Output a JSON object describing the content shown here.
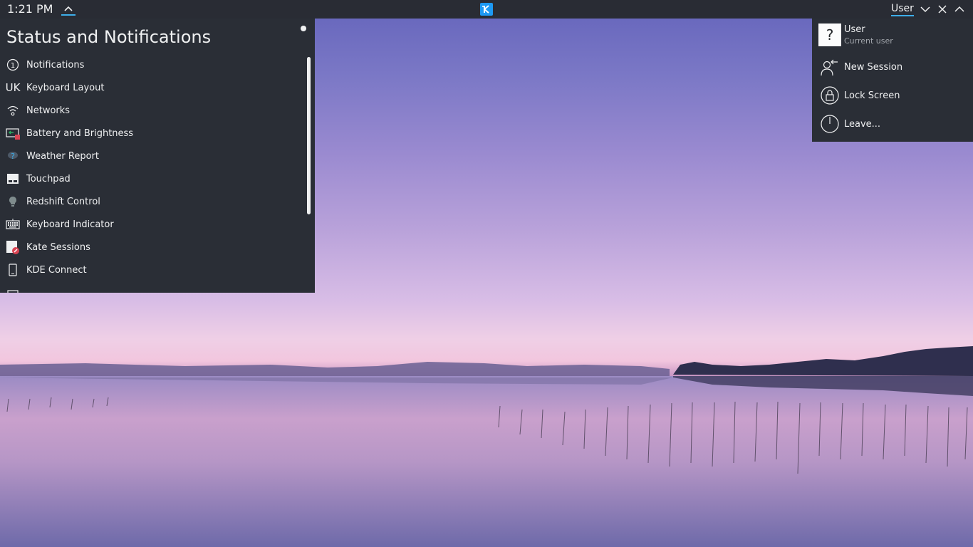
{
  "panel": {
    "clock": "1:21 PM",
    "user_label": "User",
    "accent": "#3daee9"
  },
  "status_popup": {
    "title": "Status and Notifications",
    "items": [
      {
        "label": "Notifications",
        "icon": "notification-count-icon",
        "icon_text": "1"
      },
      {
        "label": "Keyboard Layout",
        "icon": "keyboard-layout-icon",
        "icon_text": "UK"
      },
      {
        "label": "Networks",
        "icon": "wifi-icon"
      },
      {
        "label": "Battery and Brightness",
        "icon": "battery-icon"
      },
      {
        "label": "Weather Report",
        "icon": "weather-icon"
      },
      {
        "label": "Touchpad",
        "icon": "touchpad-icon"
      },
      {
        "label": "Redshift Control",
        "icon": "lightbulb-icon"
      },
      {
        "label": "Keyboard Indicator",
        "icon": "keyboard-icon"
      },
      {
        "label": "Kate Sessions",
        "icon": "kate-icon"
      },
      {
        "label": "KDE Connect",
        "icon": "phone-icon"
      }
    ]
  },
  "user_popup": {
    "user_name": "User",
    "user_subtitle": "Current user",
    "avatar_text": "?",
    "items": [
      {
        "label": "New Session",
        "icon": "new-session-icon"
      },
      {
        "label": "Lock Screen",
        "icon": "lock-icon"
      },
      {
        "label": "Leave...",
        "icon": "power-icon"
      }
    ]
  }
}
